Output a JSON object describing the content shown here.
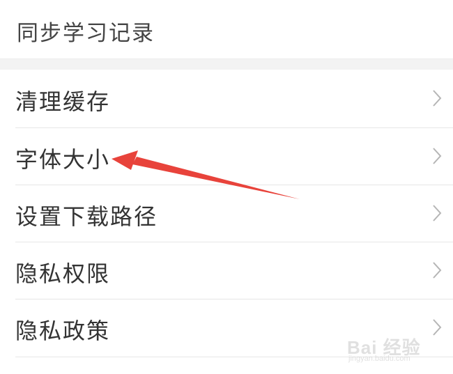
{
  "top_item": {
    "label": "同步学习记录"
  },
  "settings": {
    "items": [
      {
        "label": "清理缓存"
      },
      {
        "label": "字体大小"
      },
      {
        "label": "设置下载路径"
      },
      {
        "label": "隐私权限"
      },
      {
        "label": "隐私政策"
      }
    ]
  },
  "annotation": {
    "arrow_color": "#e8433b",
    "points_to": "字体大小"
  },
  "watermark": {
    "main": "Bai 经验",
    "sub": "jingyan.baidu.com"
  }
}
